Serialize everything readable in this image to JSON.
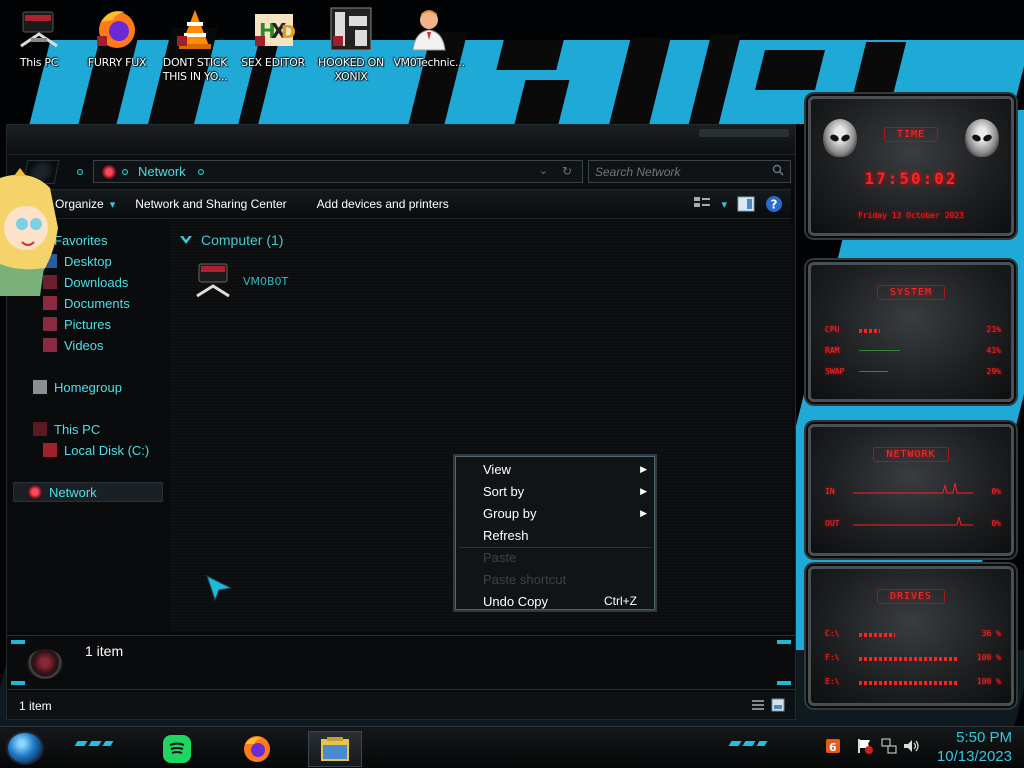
{
  "desktop": {
    "icons": [
      {
        "label": "This PC"
      },
      {
        "label": "FURRY FUX"
      },
      {
        "label": "DONT STICK THIS IN YO..."
      },
      {
        "label": "SEX EDITOR"
      },
      {
        "label": "HOOKED ON XONIX"
      },
      {
        "label": "VM0Technic..."
      }
    ]
  },
  "explorer": {
    "address": {
      "segment": "Network"
    },
    "search": {
      "placeholder": "Search Network"
    },
    "commands": {
      "organize": "Organize",
      "network_center": "Network and Sharing Center",
      "add_devices": "Add devices and printers"
    },
    "nav": {
      "favorites": "Favorites",
      "desktop": "Desktop",
      "downloads": "Downloads",
      "documents": "Documents",
      "pictures": "Pictures",
      "videos": "Videos",
      "homegroup": "Homegroup",
      "this_pc": "This PC",
      "local_disk": "Local Disk (C:)",
      "network": "Network"
    },
    "group_header": "Computer (1)",
    "items": [
      {
        "name": "VM0B0T"
      }
    ],
    "details": {
      "text": "1 item"
    },
    "status": {
      "text": "1 item"
    }
  },
  "context_menu": {
    "view": "View",
    "sort_by": "Sort by",
    "group_by": "Group by",
    "refresh": "Refresh",
    "paste": "Paste",
    "paste_shortcut": "Paste shortcut",
    "undo_copy": "Undo Copy",
    "undo_copy_shortcut": "Ctrl+Z"
  },
  "gadgets": {
    "clock": {
      "title": "TIME",
      "time": "17:50:02",
      "date": "Friday 13 October 2023"
    },
    "system": {
      "title": "SYSTEM",
      "cpu_label": "CPU",
      "cpu_value": "21%",
      "cpu_level": 0.21,
      "ram_label": "RAM",
      "ram_value": "41%",
      "ram_level": 0.41,
      "swap_label": "SWAP",
      "swap_value": "29%",
      "swap_level": 0.29
    },
    "network": {
      "title": "NETWORK",
      "in_label": "IN",
      "in_value": "0%",
      "out_label": "OUT",
      "out_value": "0%"
    },
    "drives": {
      "title": "DRIVES",
      "d1_label": "C:\\",
      "d1_value": "36 %",
      "d1_level": 0.36,
      "d2_label": "F:\\",
      "d2_value": "100 %",
      "d2_level": 1.0,
      "d3_label": "E:\\",
      "d3_value": "100 %",
      "d3_level": 1.0
    }
  },
  "taskbar": {
    "time": "5:50 PM",
    "date": "10/13/2023"
  },
  "colors": {
    "accent": "#1fb9d6",
    "nav_text": "#4be0e6",
    "gadget_red": "#ff2020"
  }
}
